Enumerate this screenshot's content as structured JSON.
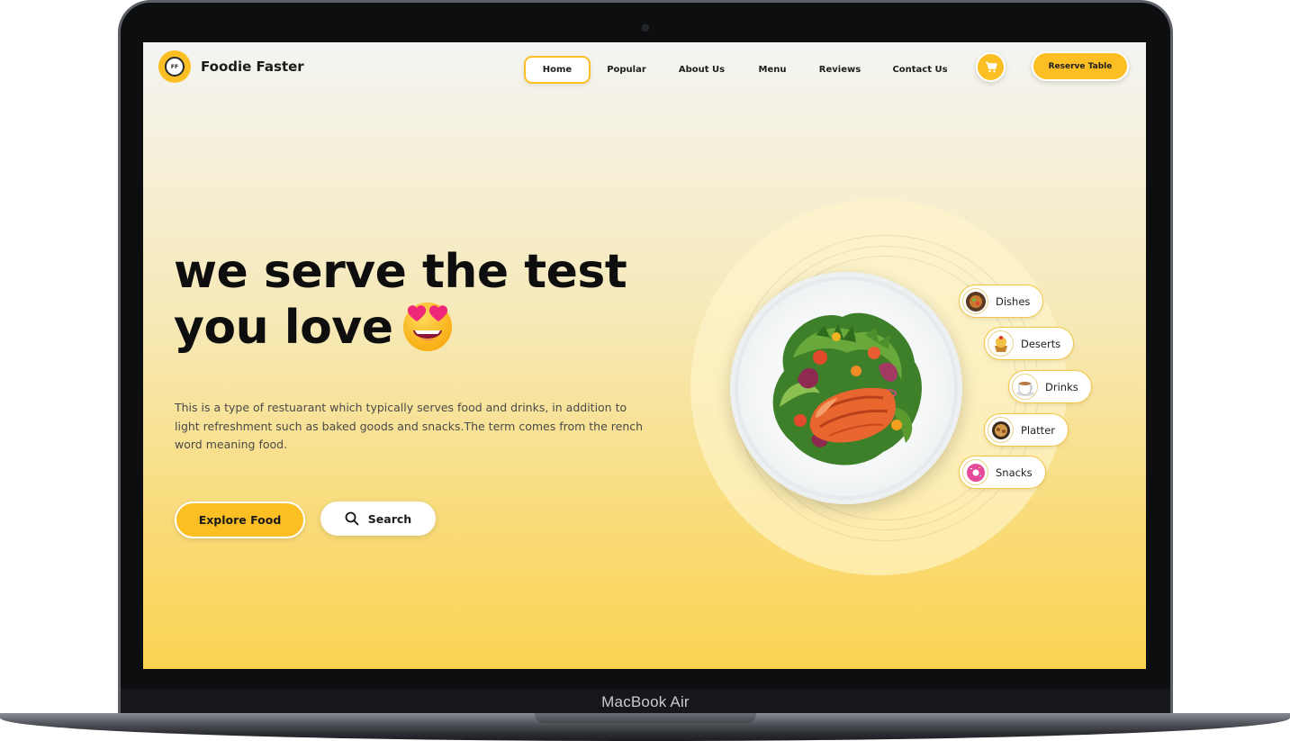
{
  "device": {
    "label": "MacBook Air"
  },
  "brand": {
    "name": "Foodie Faster",
    "logo_text": "FF",
    "logo_icon": "logo-badge-icon"
  },
  "nav": {
    "links": [
      {
        "label": "Home",
        "active": true
      },
      {
        "label": "Popular",
        "active": false
      },
      {
        "label": "About Us",
        "active": false
      },
      {
        "label": "Menu",
        "active": false
      },
      {
        "label": "Reviews",
        "active": false
      },
      {
        "label": "Contact Us",
        "active": false
      }
    ],
    "cart_icon": "cart-icon",
    "reserve_label": "Reserve Table"
  },
  "hero": {
    "title_line1": "we serve the test",
    "title_line2": "you love",
    "emoji_icon": "heart-eyes-emoji-icon",
    "description": "This is a type of restuarant which typically serves food and drinks, in addition to light refreshment such as baked goods and snacks.The term comes from the rench word meaning food.",
    "explore_label": "Explore Food",
    "search_label": "Search",
    "search_icon": "search-icon"
  },
  "categories": [
    {
      "label": "Dishes",
      "icon": "dishes-icon"
    },
    {
      "label": "Deserts",
      "icon": "deserts-icon"
    },
    {
      "label": "Drinks",
      "icon": "drinks-icon"
    },
    {
      "label": "Platter",
      "icon": "platter-icon"
    },
    {
      "label": "Snacks",
      "icon": "snacks-icon"
    }
  ],
  "colors": {
    "accent": "#fbbf24",
    "text_dark": "#1a1a1a",
    "background_bottom": "#fbd352"
  }
}
